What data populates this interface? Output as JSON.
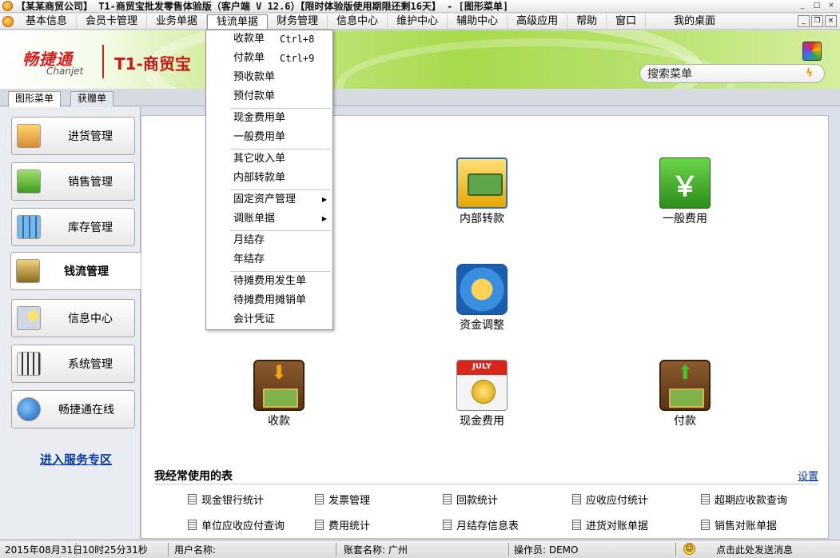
{
  "window": {
    "title": "【某某商贸公司】 T1-商贸宝批发零售体验版（客户端 V 12.6）【限时体验版使用期限还剩16天】 - [图形菜单]",
    "controls": [
      "_",
      "□",
      "×"
    ]
  },
  "menubar": {
    "items": [
      "基本信息",
      "会员卡管理",
      "业务单据",
      "钱流单据",
      "财务管理",
      "信息中心",
      "维护中心",
      "辅助中心",
      "高级应用",
      "帮助",
      "窗口",
      "我的桌面"
    ],
    "active": "钱流单据",
    "mdi_controls": [
      "_",
      "❐",
      "×"
    ]
  },
  "banner": {
    "brand_cn": "畅捷通",
    "brand_en": "Chanjet",
    "product": "T1-商贸宝",
    "search_label": "搜索菜单",
    "search_value": ""
  },
  "tabs": [
    "图形菜单",
    "获赠单"
  ],
  "nav": [
    {
      "label": "进货管理",
      "icon": "purchase-icon"
    },
    {
      "label": "销售管理",
      "icon": "sales-basket-icon"
    },
    {
      "label": "库存管理",
      "icon": "inventory-icon"
    },
    {
      "label": "钱流管理",
      "icon": "cash-flow-icon"
    },
    {
      "label": "信息中心",
      "icon": "info-center-icon"
    },
    {
      "label": "系统管理",
      "icon": "system-settings-icon"
    },
    {
      "label": "畅捷通在线",
      "icon": "online-globe-icon"
    }
  ],
  "nav_active": "钱流管理",
  "service_link": "进入服务专区",
  "features": {
    "internal_transfer": "内部转款",
    "general_expense": "一般费用",
    "fund_adjust": "资金调整",
    "receive": "收款",
    "cash_expense": "现金费用",
    "cash_month": "JULY",
    "pay": "付款"
  },
  "frequent": {
    "title": "我经常使用的表",
    "settings": "设置",
    "items": [
      "现金银行统计",
      "发票管理",
      "回款统计",
      "应收应付统计",
      "超期应收款查询",
      "单位应收应付查询",
      "费用统计",
      "月结存信息表",
      "进货对账单据",
      "销售对账单据"
    ]
  },
  "dropdown": {
    "items": [
      {
        "label": "收款单",
        "shortcut": "Ctrl+8"
      },
      {
        "label": "付款单",
        "shortcut": "Ctrl+9"
      },
      {
        "label": "预收款单"
      },
      {
        "label": "预付款单"
      },
      {
        "label": "现金费用单"
      },
      {
        "label": "一般费用单"
      },
      {
        "label": "其它收入单"
      },
      {
        "label": "内部转款单"
      },
      {
        "label": "固定资产管理",
        "submenu": true
      },
      {
        "label": "调账单据",
        "submenu": true
      },
      {
        "label": "月结存"
      },
      {
        "label": "年结存"
      },
      {
        "label": "待摊费用发生单"
      },
      {
        "label": "待摊费用摊销单"
      },
      {
        "label": "会计凭证"
      }
    ],
    "submenu_arrow": "▶"
  },
  "statusbar": {
    "date": "2015年08月31日",
    "time": "10时25分31秒",
    "user": "用户名称:",
    "account": "账套名称: 广州",
    "operator": "操作员: DEMO",
    "smile": "☺",
    "feedback": "点击此处发送消息"
  },
  "colors": {
    "brand_red": "#d42020",
    "banner_green": "#a8d94c",
    "link_blue": "#0a3a9e"
  }
}
